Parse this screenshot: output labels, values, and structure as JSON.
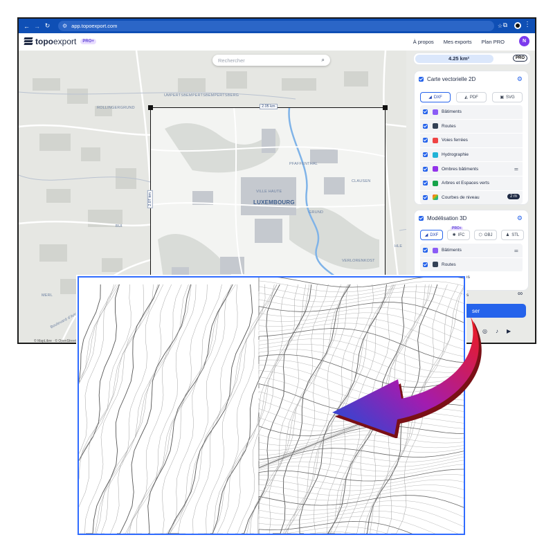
{
  "browser": {
    "url": "app.topoexport.com"
  },
  "app": {
    "logo_bold": "topo",
    "logo_regular": "export",
    "pro_badge": "PRO+",
    "nav": [
      "À propos",
      "Mes exports",
      "Plan PRO"
    ],
    "avatar_initial": "N"
  },
  "map": {
    "search_placeholder": "Rechercher",
    "labels": {
      "top_street": "UMPERTSBEMPERTSBEMPERTSBERG",
      "rollingergrund": "ROLLINGERGRUND",
      "pfaffenthal": "PFAFFENTHAL",
      "clausen": "CLAUSEN",
      "ville_haute": "VILLE HAUTE",
      "grund": "GRUND",
      "verlorenkost": "VERLORENKOST",
      "bui": "BUI",
      "merl": "MERL",
      "hle": "HLE",
      "boulevard": "Boulevard d'Arlon"
    },
    "city": "LUXEMBOURG",
    "width_label": "2.05 km",
    "height_label": "2.07 km",
    "attribution": "© MapLibre · © OpenStreetMap"
  },
  "panel": {
    "area": "4.25 km²",
    "area_fill_fraction": 0.69,
    "pro": "PRO",
    "vector": {
      "title": "Carte vectorielle 2D",
      "formats": [
        "DXF",
        "PDF",
        "SVG"
      ],
      "layers": [
        {
          "label": "Bâtiments",
          "color": "#8b5cf6"
        },
        {
          "label": "Routes",
          "color": "#334155"
        },
        {
          "label": "Voies ferrées",
          "color": "#ef4444"
        },
        {
          "label": "Hydrographie",
          "color": "#22b3d6"
        },
        {
          "label": "Ombres bâtiments",
          "color": "#9333ea"
        },
        {
          "label": "Arbres et Espaces verts",
          "color": "#16a34a"
        },
        {
          "label": "Courbes de niveau",
          "color": "#f59e0b"
        }
      ],
      "contour_interval": "2 m"
    },
    "model3d": {
      "title": "Modélisation 3D",
      "formats": [
        "DXF",
        "IFC",
        "OBJ",
        "STL"
      ],
      "ifc_badge": "PRO+",
      "layers": [
        {
          "label": "Bâtiments",
          "color": "#8b5cf6"
        },
        {
          "label": "Routes",
          "color": "#334155"
        },
        {
          "label": "ées",
          "color": "#ef4444"
        },
        {
          "label": "nts",
          "color": "#9ca3af"
        }
      ]
    },
    "infinity": "∞",
    "export_label": "ser"
  },
  "colors": {
    "brand_blue": "#2563eb",
    "browser_blue": "#0f4fb5",
    "zoom_border": "#2f6bff"
  }
}
